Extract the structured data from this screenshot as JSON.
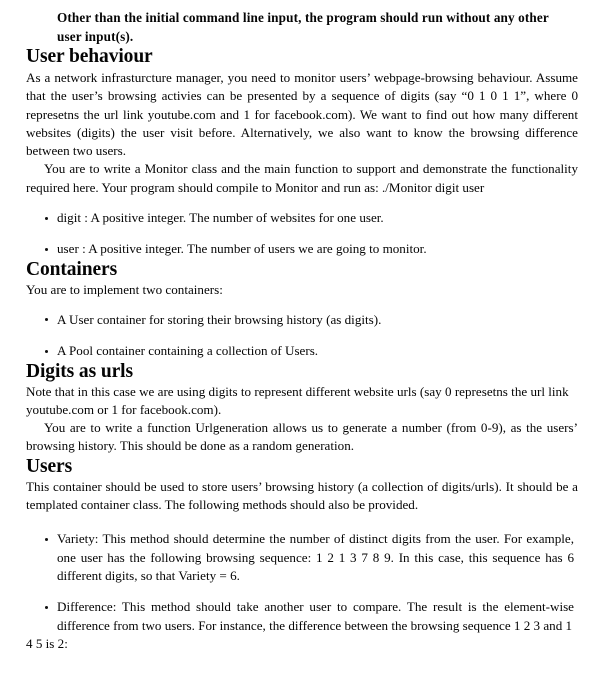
{
  "document": {
    "lead_bold_paragraph": "Other than the initial command line input, the program should run without any other user input(s).",
    "sections": [
      {
        "heading": "User behaviour",
        "paragraphs": [
          "As a network infrasturcture manager, you need to monitor users’ webpage-browsing behaviour. Assume that the user’s browsing activies can be presented by a sequence of digits (say “0 1 0 1 1”, where 0 represetns the url link youtube.com and 1 for facebook.com). We want to find out how many different websites (digits) the user visit before. Alternatively, we also want to know the browsing difference between two users.",
          "You are to write a Monitor class and the main function to support and demonstrate the functionality required here. Your program should compile to Monitor and run as: ./Monitor digit user"
        ],
        "bullets": [
          "digit : A positive integer. The number of websites for one user.",
          "user : A positive integer. The number of users we are going to monitor."
        ]
      },
      {
        "heading": "Containers",
        "paragraphs": [
          "You are to implement two containers:"
        ],
        "bullets": [
          "A User container for storing their browsing history (as digits).",
          "A Pool container containing a collection of Users."
        ]
      },
      {
        "heading": "Digits as urls",
        "paragraphs": [
          "Note that in this case we are using digits to represent different website urls (say 0 represetns the url link youtube.com or 1 for facebook.com).",
          "You are to write a function Urlgeneration allows us to generate a number (from 0-9), as the users’ browsing history. This should be done as a random generation."
        ],
        "bullets": []
      },
      {
        "heading": "Users",
        "paragraphs": [
          "This container should be used to store users’ browsing history (a collection of digits/urls). It should be a templated container class. The following methods should also be provided."
        ],
        "bullets": [
          "Variety: This method should determine the number of distinct digits from the user. For example, one user has the following browsing sequence: 1 2 1 3 7 8 9. In this case, this sequence has 6 different digits, so that Variety = 6.",
          "Difference: This method should take another user to compare. The result is the element-wise difference from two users. For instance, the difference between the browsing sequence 1 2 3 and 1"
        ],
        "trailing_line": "4 5 is 2:"
      }
    ]
  }
}
